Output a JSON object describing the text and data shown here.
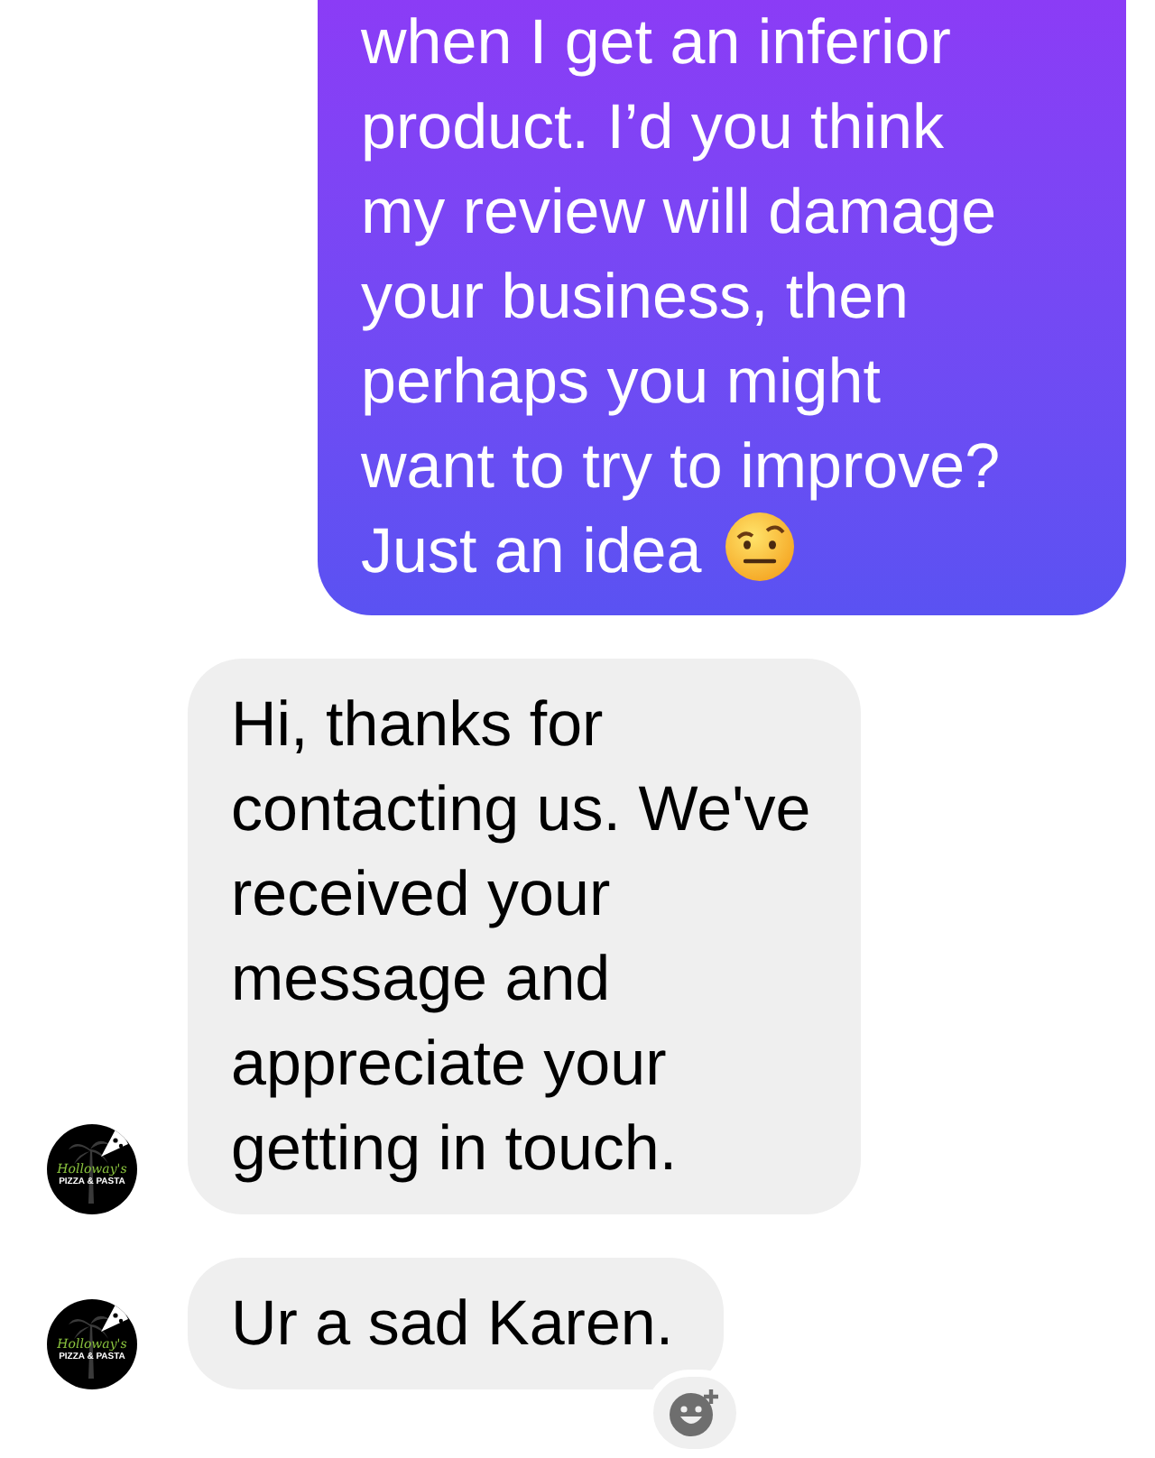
{
  "messages": [
    {
      "kind": "sent",
      "text": "when I get an inferior\nproduct. I’d you think\nmy review will damage\nyour business, then\nperhaps you might\nwant to try to improve?\nJust an idea",
      "trailing_emoji": true
    },
    {
      "kind": "received",
      "text": "Hi, thanks for\ncontacting us. We've\nreceived your\nmessage and\nappreciate your\ngetting in touch.",
      "avatar": {
        "title": "Holloway's",
        "subtitle": "PIZZA & PASTA"
      }
    },
    {
      "kind": "received",
      "text": "Ur a sad Karen.",
      "avatar": {
        "title": "Holloway's",
        "subtitle": "PIZZA & PASTA"
      },
      "add_reaction": true
    }
  ]
}
